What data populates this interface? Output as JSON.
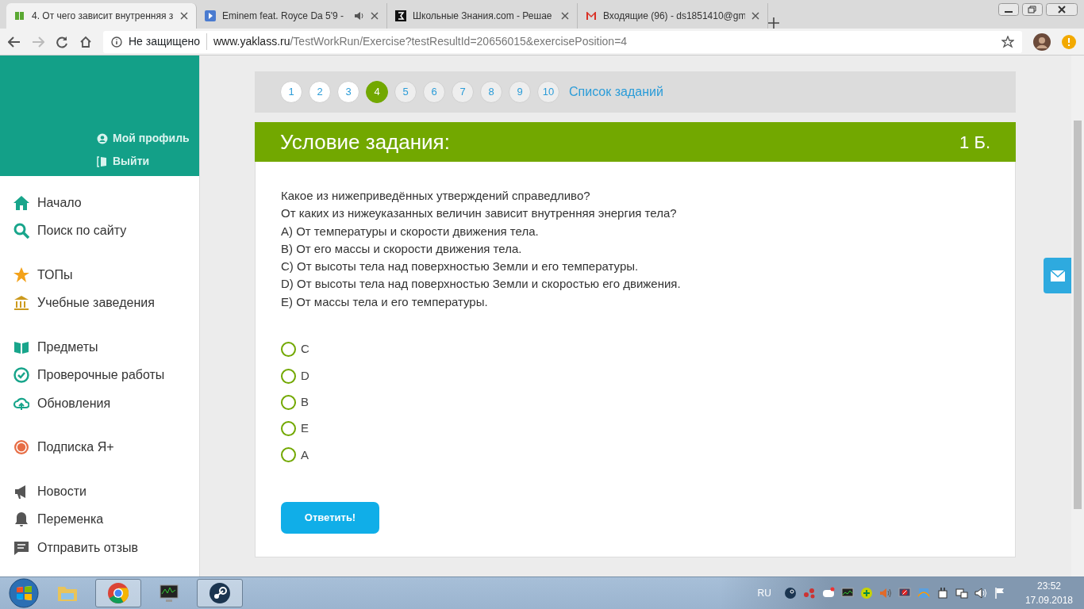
{
  "browser": {
    "tabs": [
      {
        "title": "4. От чего зависит внутренняя з",
        "selected": true,
        "audio": false
      },
      {
        "title": "Eminem feat. Royce Da 5'9 -",
        "selected": false,
        "audio": true
      },
      {
        "title": "Школьные Знания.com - Решае",
        "selected": false,
        "audio": false
      },
      {
        "title": "Входящие (96) - ds1851410@gm",
        "selected": false,
        "audio": false
      }
    ],
    "security": "Не защищено",
    "url_host": "www.yaklass.ru",
    "url_path": "/TestWorkRun/Exercise?testResultId=20656015&exercisePosition=4"
  },
  "sidebar": {
    "profile_links": [
      "Мой профиль",
      "Выйти"
    ],
    "sections": [
      {
        "items": [
          "Начало",
          "Поиск по сайту"
        ]
      },
      {
        "items": [
          "ТОПы",
          "Учебные заведения"
        ]
      },
      {
        "items": [
          "Предметы",
          "Проверочные работы",
          "Обновления"
        ]
      },
      {
        "items": [
          "Подписка Я+"
        ]
      },
      {
        "items": [
          "Новости",
          "Переменка",
          "Отправить отзыв"
        ]
      }
    ]
  },
  "pager": {
    "pages": [
      {
        "label": "1",
        "selected": false,
        "visited": true
      },
      {
        "label": "2",
        "selected": false,
        "visited": true
      },
      {
        "label": "3",
        "selected": false,
        "visited": true
      },
      {
        "label": "4",
        "selected": true,
        "visited": true
      },
      {
        "label": "5",
        "selected": false,
        "visited": false
      },
      {
        "label": "6",
        "selected": false,
        "visited": false
      },
      {
        "label": "7",
        "selected": false,
        "visited": false
      },
      {
        "label": "8",
        "selected": false,
        "visited": false
      },
      {
        "label": "9",
        "selected": false,
        "visited": false
      },
      {
        "label": "10",
        "selected": false,
        "visited": false
      }
    ],
    "list_link": "Список заданий"
  },
  "task": {
    "title": "Условие задания:",
    "points": "1 Б.",
    "lines": [
      "Какое из нижеприведённых утверждений справедливо?",
      "От каких из нижеуказанных величин зависит внутренняя энергия тела?",
      "A) От температуры и скорости движения тела.",
      "B) От его массы и скорости движения тела.",
      "C) От высоты тела над поверхностью Земли и его температуры.",
      "D) От высоты тела над поверхностью Земли и скоростью его движения.",
      "E) От массы тела и его температуры."
    ],
    "options": [
      {
        "label": "C",
        "selected": false
      },
      {
        "label": "D",
        "selected": false
      },
      {
        "label": "B",
        "selected": false
      },
      {
        "label": "E",
        "selected": false
      },
      {
        "label": "A",
        "selected": false
      }
    ],
    "submit": "Ответить!"
  },
  "taskbar": {
    "apps": [
      {
        "kind": "explorer",
        "active": false
      },
      {
        "kind": "chrome",
        "active": true
      },
      {
        "kind": "monitor",
        "active": false
      },
      {
        "kind": "steam",
        "active": true
      }
    ],
    "language": "RU",
    "time": "23:52",
    "date": "17.09.2018"
  }
}
